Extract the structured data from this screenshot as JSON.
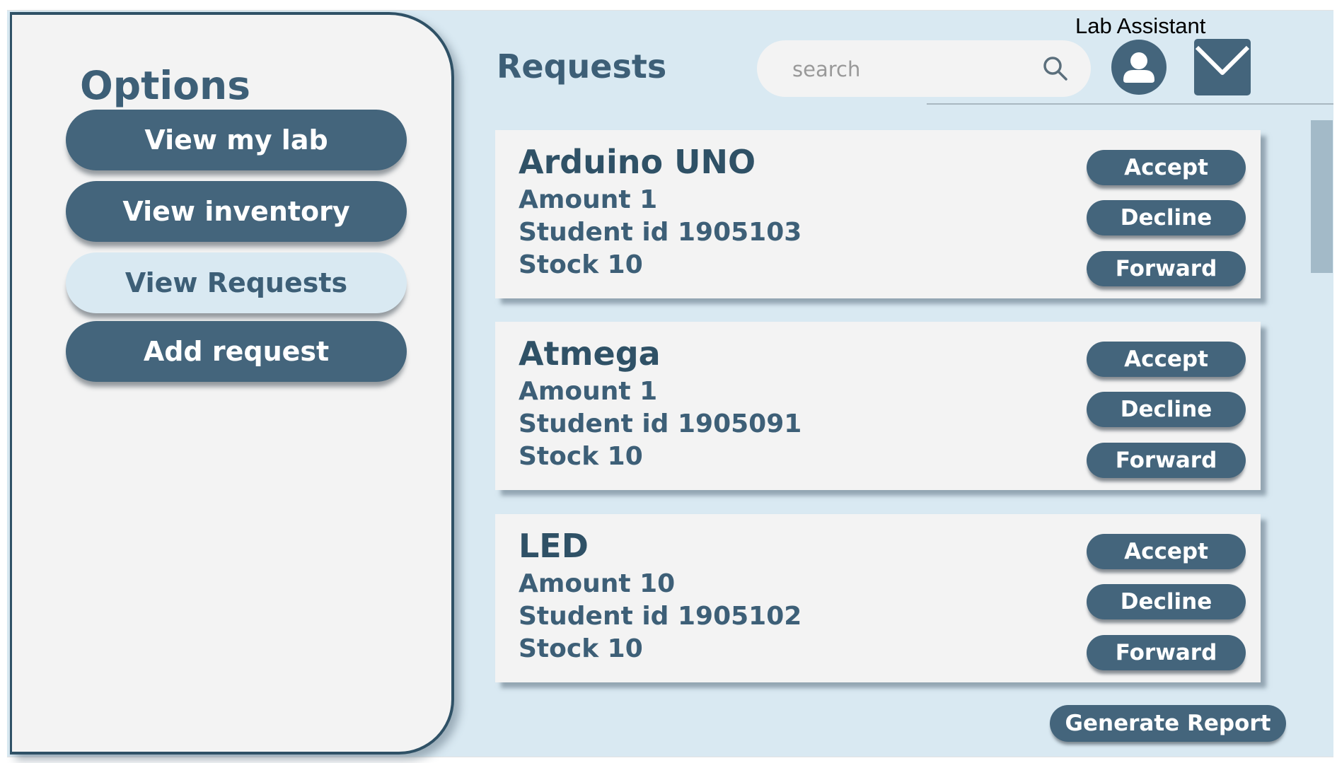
{
  "sidebar": {
    "title": "Options",
    "items": [
      {
        "label": "View my lab",
        "active": false
      },
      {
        "label": "View inventory",
        "active": false
      },
      {
        "label": "View Requests",
        "active": true
      },
      {
        "label": "Add request",
        "active": false
      }
    ]
  },
  "header": {
    "title": "Requests",
    "search_placeholder": "search",
    "search_value": "",
    "role_label": "Lab Assistant",
    "icons": [
      "search-icon",
      "user-avatar-icon",
      "mail-icon"
    ]
  },
  "requests": [
    {
      "name": "Arduino UNO",
      "amount": "Amount 1",
      "student_id": "Student id 1905103",
      "stock": "Stock 10",
      "actions": {
        "accept": "Accept",
        "decline": "Decline",
        "forward": "Forward"
      }
    },
    {
      "name": "Atmega",
      "amount": "Amount 1",
      "student_id": "Student id 1905091",
      "stock": "Stock 10",
      "actions": {
        "accept": "Accept",
        "decline": "Decline",
        "forward": "Forward"
      }
    },
    {
      "name": "LED",
      "amount": "Amount 10",
      "student_id": "Student id 1905102",
      "stock": "Stock 10",
      "actions": {
        "accept": "Accept",
        "decline": "Decline",
        "forward": "Forward"
      }
    }
  ],
  "footer": {
    "report_label": "Generate Report"
  },
  "colors": {
    "background": "#d9e9f2",
    "panel": "#f3f3f3",
    "primary": "#44657c",
    "heading": "#3d5f77",
    "border": "#2f5166"
  }
}
